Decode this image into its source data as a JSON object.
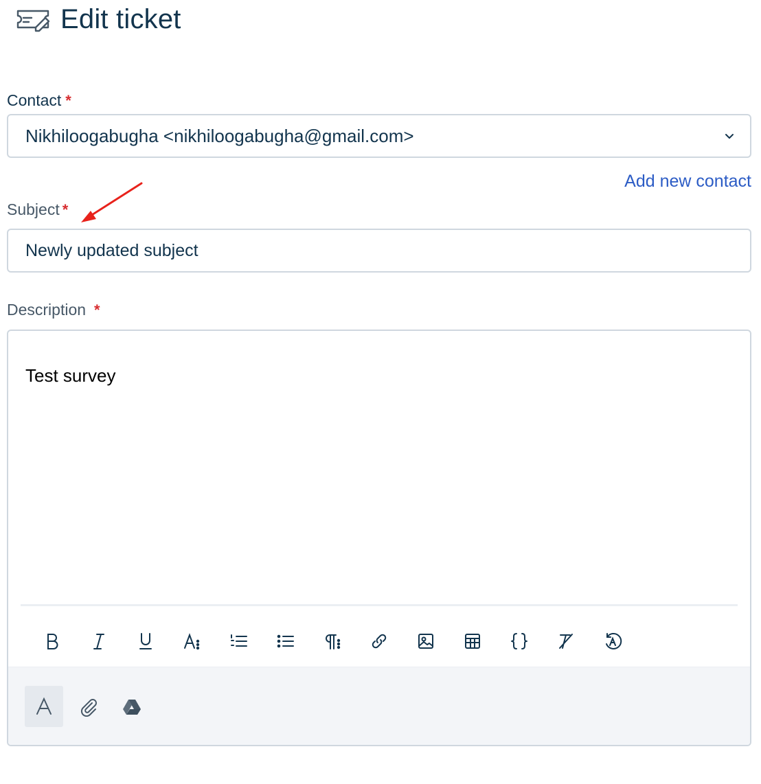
{
  "header": {
    "title": "Edit ticket",
    "icon": "ticket-edit-icon"
  },
  "contact": {
    "label": "Contact",
    "required_mark": "*",
    "value": "Nikhiloogabugha <nikhiloogabugha@gmail.com>",
    "add_new_label": "Add new contact"
  },
  "subject": {
    "label": "Subject",
    "required_mark": "*",
    "value": "Newly updated subject"
  },
  "description": {
    "label": "Description",
    "required_mark": "*",
    "value": "Test survey",
    "toolbar": [
      "bold-icon",
      "italic-icon",
      "underline-icon",
      "font-size-icon",
      "ordered-list-icon",
      "unordered-list-icon",
      "paragraph-icon",
      "link-icon",
      "image-icon",
      "table-icon",
      "code-braces-icon",
      "clear-format-icon",
      "autocorrect-icon"
    ],
    "footer": [
      "text-format-icon",
      "attachment-icon",
      "google-drive-icon"
    ]
  },
  "colors": {
    "accent": "#2c5cc5",
    "required": "#d72d30",
    "text": "#12344d",
    "annotation_arrow": "#e8221b"
  }
}
